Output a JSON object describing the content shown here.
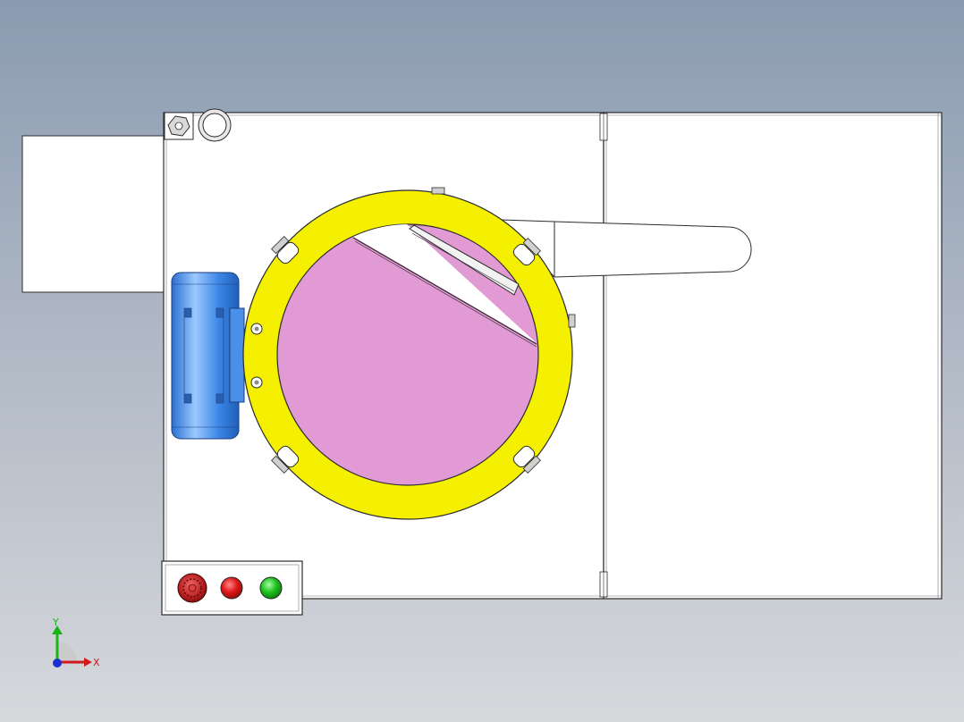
{
  "view": {
    "background_top": "#8a9bb1",
    "background_bottom": "#d6d8dc"
  },
  "colors": {
    "panel": "#ffffff",
    "outline": "#2b2b2b",
    "flange": "#f5f000",
    "chamber": "#e19ad4",
    "motor": "#3c86e6",
    "motor_highlight": "#9cc9ff",
    "button_red": "#e01818",
    "button_green": "#1fc21f",
    "estop": "#b81f1f"
  },
  "components": {
    "side_panel": "side-panel",
    "main_table": "main-table",
    "extension_table": "extension-table",
    "flange_ring": "flange-ring",
    "chamber": "chamber",
    "motor": "drive-motor",
    "chute": "discharge-chute",
    "control_box": "control-box"
  },
  "control_panel": {
    "buttons": [
      {
        "name": "emergency-stop-button",
        "color": "#b81f1f"
      },
      {
        "name": "stop-button",
        "color": "#e01818"
      },
      {
        "name": "start-button",
        "color": "#1fc21f"
      }
    ]
  },
  "triad": {
    "x_label": "X",
    "y_label": "Y",
    "x_color": "#d11a1a",
    "y_color": "#18b418",
    "z_color": "#1a2fd1"
  }
}
